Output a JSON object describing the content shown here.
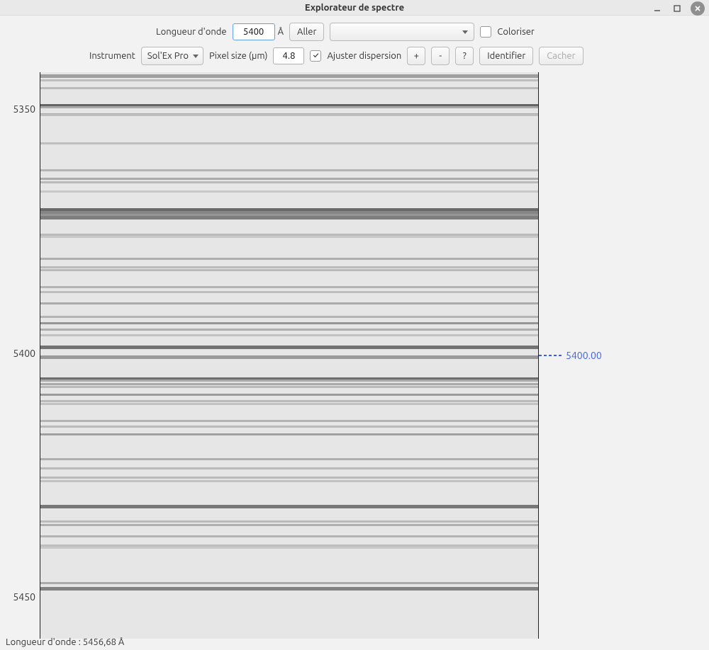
{
  "window": {
    "title": "Explorateur de spectre"
  },
  "toolbar": {
    "row1": {
      "wavelength_label": "Longueur d'onde",
      "wavelength_value": "5400",
      "unit": "Å",
      "go_btn": "Aller",
      "line_select": "",
      "colorize_label": "Coloriser"
    },
    "row2": {
      "instrument_label": "Instrument",
      "instrument_value": "Sol'Ex Pro",
      "pixel_label": "Pixel size (µm)",
      "pixel_value": "4.8",
      "adjust_label": "Ajuster dispersion",
      "plus": "+",
      "minus": "-",
      "help": "?",
      "identify": "Identifier",
      "hide": "Cacher"
    }
  },
  "axis": {
    "t0": "5350",
    "t1": "5400",
    "t2": "5450"
  },
  "marker": {
    "value": "5400.00"
  },
  "status": {
    "text": "Longueur d'onde : 5456,68 Å"
  },
  "lines": [
    {
      "y": 0.004,
      "h": 1.5,
      "d": 0.35
    },
    {
      "y": 0.013,
      "h": 1.0,
      "d": 0.2
    },
    {
      "y": 0.026,
      "h": 1.0,
      "d": 0.22
    },
    {
      "y": 0.056,
      "h": 2.0,
      "d": 0.65
    },
    {
      "y": 0.06,
      "h": 1.0,
      "d": 0.3
    },
    {
      "y": 0.072,
      "h": 1.0,
      "d": 0.3
    },
    {
      "y": 0.074,
      "h": 1.0,
      "d": 0.2
    },
    {
      "y": 0.124,
      "h": 1.0,
      "d": 0.2
    },
    {
      "y": 0.171,
      "h": 1.0,
      "d": 0.25
    },
    {
      "y": 0.186,
      "h": 1.2,
      "d": 0.3
    },
    {
      "y": 0.192,
      "h": 1.0,
      "d": 0.22
    },
    {
      "y": 0.209,
      "h": 1.0,
      "d": 0.15
    },
    {
      "y": 0.24,
      "h": 2.0,
      "d": 0.62
    },
    {
      "y": 0.245,
      "h": 1.5,
      "d": 0.48
    },
    {
      "y": 0.25,
      "h": 1.5,
      "d": 0.4
    },
    {
      "y": 0.254,
      "h": 1.5,
      "d": 0.52
    },
    {
      "y": 0.285,
      "h": 1.0,
      "d": 0.22
    },
    {
      "y": 0.289,
      "h": 1.0,
      "d": 0.15
    },
    {
      "y": 0.328,
      "h": 1.0,
      "d": 0.28
    },
    {
      "y": 0.343,
      "h": 1.0,
      "d": 0.22
    },
    {
      "y": 0.348,
      "h": 1.0,
      "d": 0.22
    },
    {
      "y": 0.377,
      "h": 1.0,
      "d": 0.25
    },
    {
      "y": 0.386,
      "h": 1.0,
      "d": 0.2
    },
    {
      "y": 0.406,
      "h": 1.0,
      "d": 0.3
    },
    {
      "y": 0.43,
      "h": 1.0,
      "d": 0.25
    },
    {
      "y": 0.441,
      "h": 1.2,
      "d": 0.4
    },
    {
      "y": 0.452,
      "h": 1.0,
      "d": 0.28
    },
    {
      "y": 0.463,
      "h": 1.0,
      "d": 0.18
    },
    {
      "y": 0.482,
      "h": 1.8,
      "d": 0.58
    },
    {
      "y": 0.5,
      "h": 1.5,
      "d": 0.38
    },
    {
      "y": 0.539,
      "h": 2.0,
      "d": 0.6
    },
    {
      "y": 0.543,
      "h": 1.0,
      "d": 0.3
    },
    {
      "y": 0.549,
      "h": 1.0,
      "d": 0.3
    },
    {
      "y": 0.554,
      "h": 1.0,
      "d": 0.22
    },
    {
      "y": 0.568,
      "h": 1.0,
      "d": 0.38
    },
    {
      "y": 0.579,
      "h": 1.0,
      "d": 0.22
    },
    {
      "y": 0.584,
      "h": 1.0,
      "d": 0.18
    },
    {
      "y": 0.614,
      "h": 1.0,
      "d": 0.25
    },
    {
      "y": 0.624,
      "h": 1.0,
      "d": 0.22
    },
    {
      "y": 0.638,
      "h": 1.0,
      "d": 0.35
    },
    {
      "y": 0.681,
      "h": 1.0,
      "d": 0.28
    },
    {
      "y": 0.698,
      "h": 1.0,
      "d": 0.22
    },
    {
      "y": 0.714,
      "h": 1.0,
      "d": 0.22
    },
    {
      "y": 0.72,
      "h": 1.0,
      "d": 0.18
    },
    {
      "y": 0.764,
      "h": 1.5,
      "d": 0.55
    },
    {
      "y": 0.791,
      "h": 1.0,
      "d": 0.22
    },
    {
      "y": 0.797,
      "h": 1.0,
      "d": 0.28
    },
    {
      "y": 0.818,
      "h": 1.0,
      "d": 0.25
    },
    {
      "y": 0.834,
      "h": 1.0,
      "d": 0.2
    },
    {
      "y": 0.838,
      "h": 1.0,
      "d": 0.15
    },
    {
      "y": 0.9,
      "h": 1.0,
      "d": 0.3
    },
    {
      "y": 0.909,
      "h": 1.5,
      "d": 0.5
    }
  ]
}
